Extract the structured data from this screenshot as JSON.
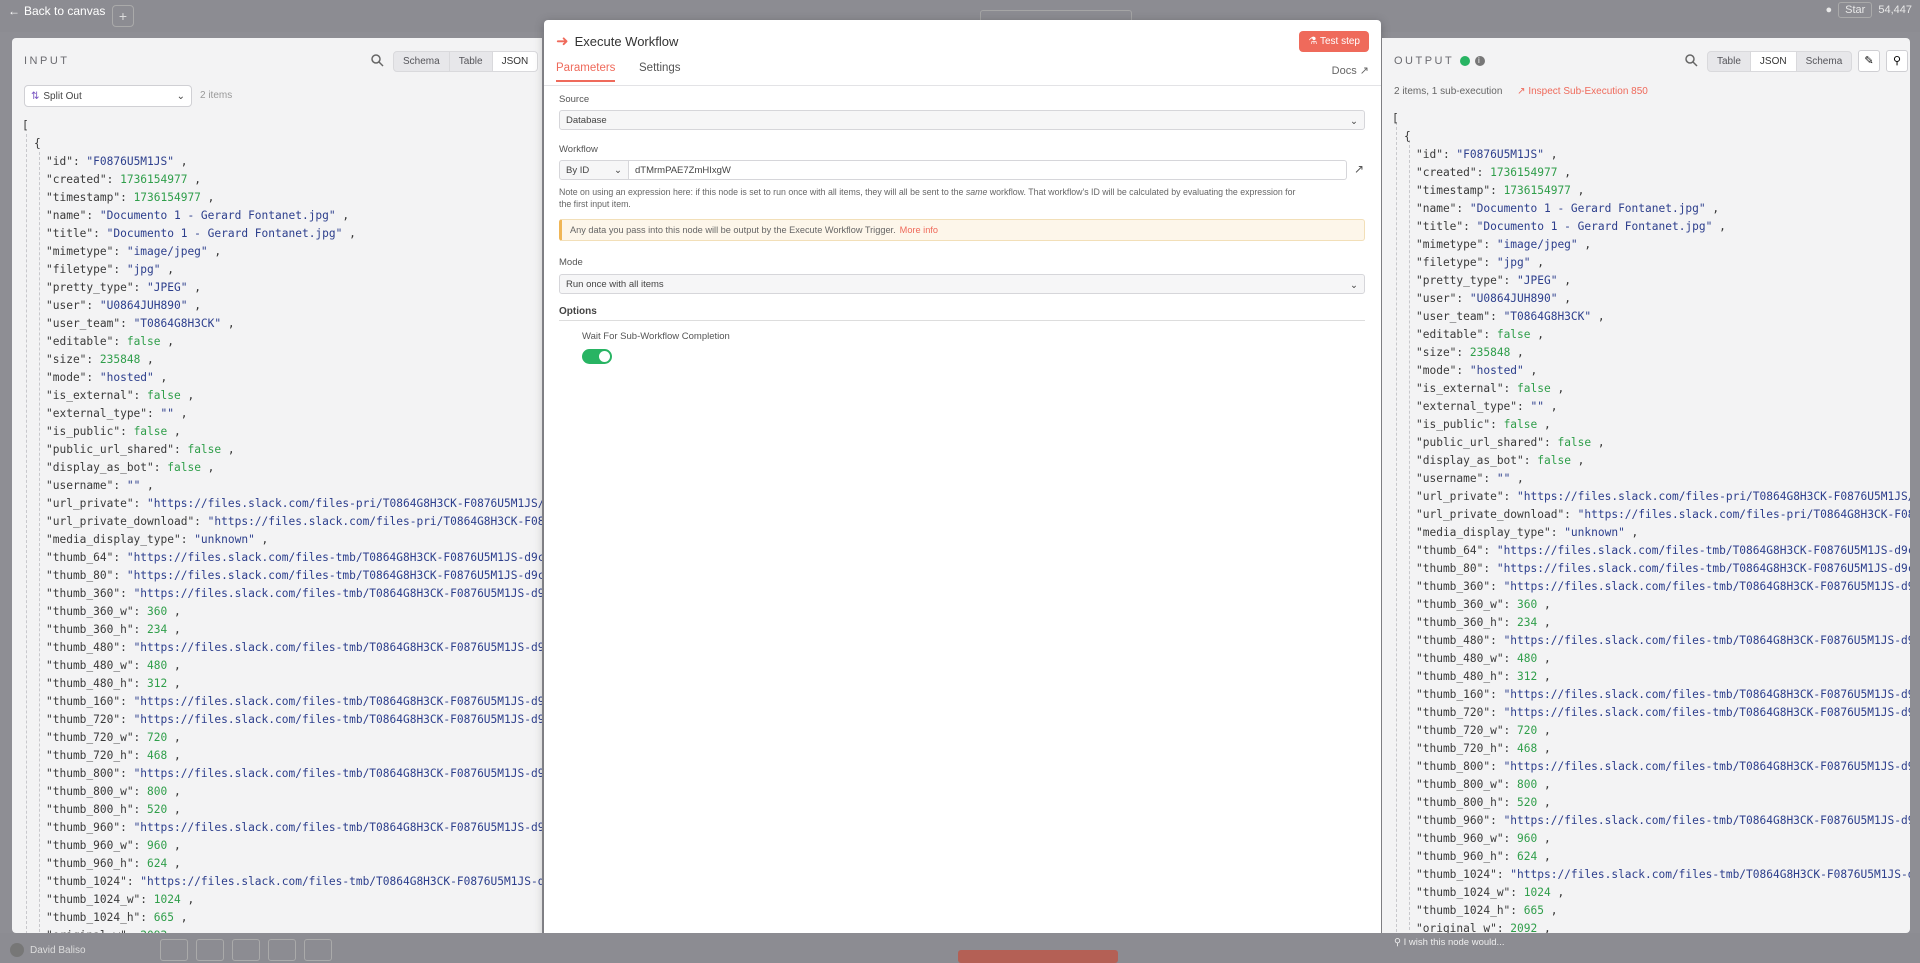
{
  "topbar": {
    "back_label": "Back to canvas",
    "star_label": "Star",
    "star_count": "54,447"
  },
  "input_panel": {
    "title": "INPUT",
    "views": [
      "Schema",
      "Table",
      "JSON"
    ],
    "active_view": "JSON",
    "node_select": "Split Out",
    "items_count": "2 items",
    "json_lines": [
      [
        "[",
        "p",
        0
      ],
      [
        "{",
        "p",
        1
      ],
      [
        "\"id\": ",
        "k",
        2,
        "\"F0876U5M1JS\"",
        "s"
      ],
      [
        "\"created\": ",
        "k",
        2,
        "1736154977",
        "n"
      ],
      [
        "\"timestamp\": ",
        "k",
        2,
        "1736154977",
        "n"
      ],
      [
        "\"name\": ",
        "k",
        2,
        "\"Documento 1 - Gerard Fontanet.jpg\"",
        "s"
      ],
      [
        "\"title\": ",
        "k",
        2,
        "\"Documento 1 - Gerard Fontanet.jpg\"",
        "s"
      ],
      [
        "\"mimetype\": ",
        "k",
        2,
        "\"image/jpeg\"",
        "s"
      ],
      [
        "\"filetype\": ",
        "k",
        2,
        "\"jpg\"",
        "s"
      ],
      [
        "\"pretty_type\": ",
        "k",
        2,
        "\"JPEG\"",
        "s"
      ],
      [
        "\"user\": ",
        "k",
        2,
        "\"U0864JUH890\"",
        "s"
      ],
      [
        "\"user_team\": ",
        "k",
        2,
        "\"T0864G8H3CK\"",
        "s"
      ],
      [
        "\"editable\": ",
        "k",
        2,
        "false",
        "b"
      ],
      [
        "\"size\": ",
        "k",
        2,
        "235848",
        "n"
      ],
      [
        "\"mode\": ",
        "k",
        2,
        "\"hosted\"",
        "s"
      ],
      [
        "\"is_external\": ",
        "k",
        2,
        "false",
        "b"
      ],
      [
        "\"external_type\": ",
        "k",
        2,
        "\"\"",
        "s"
      ],
      [
        "\"is_public\": ",
        "k",
        2,
        "false",
        "b"
      ],
      [
        "\"public_url_shared\": ",
        "k",
        2,
        "false",
        "b"
      ],
      [
        "\"display_as_bot\": ",
        "k",
        2,
        "false",
        "b"
      ],
      [
        "\"username\": ",
        "k",
        2,
        "\"\"",
        "s"
      ],
      [
        "\"url_private\": ",
        "k",
        2,
        "\"https://files.slack.com/files-pri/T0864G8H3CK-F0876U5M1JS/docu",
        "s"
      ],
      [
        "\"url_private_download\": ",
        "k",
        2,
        "\"https://files.slack.com/files-pri/T0864G8H3CK-F0876U5",
        "s"
      ],
      [
        "\"media_display_type\": ",
        "k",
        2,
        "\"unknown\"",
        "s"
      ],
      [
        "\"thumb_64\": ",
        "k",
        2,
        "\"https://files.slack.com/files-tmb/T0864G8H3CK-F0876U5M1JS-d9c9336",
        "s"
      ],
      [
        "\"thumb_80\": ",
        "k",
        2,
        "\"https://files.slack.com/files-tmb/T0864G8H3CK-F0876U5M1JS-d9c9336",
        "s"
      ],
      [
        "\"thumb_360\": ",
        "k",
        2,
        "\"https://files.slack.com/files-tmb/T0864G8H3CK-F0876U5M1JS-d9c933",
        "s"
      ],
      [
        "\"thumb_360_w\": ",
        "k",
        2,
        "360",
        "n"
      ],
      [
        "\"thumb_360_h\": ",
        "k",
        2,
        "234",
        "n"
      ],
      [
        "\"thumb_480\": ",
        "k",
        2,
        "\"https://files.slack.com/files-tmb/T0864G8H3CK-F0876U5M1JS-d9c933",
        "s"
      ],
      [
        "\"thumb_480_w\": ",
        "k",
        2,
        "480",
        "n"
      ],
      [
        "\"thumb_480_h\": ",
        "k",
        2,
        "312",
        "n"
      ],
      [
        "\"thumb_160\": ",
        "k",
        2,
        "\"https://files.slack.com/files-tmb/T0864G8H3CK-F0876U5M1JS-d9c933",
        "s"
      ],
      [
        "\"thumb_720\": ",
        "k",
        2,
        "\"https://files.slack.com/files-tmb/T0864G8H3CK-F0876U5M1JS-d9c933",
        "s"
      ],
      [
        "\"thumb_720_w\": ",
        "k",
        2,
        "720",
        "n"
      ],
      [
        "\"thumb_720_h\": ",
        "k",
        2,
        "468",
        "n"
      ],
      [
        "\"thumb_800\": ",
        "k",
        2,
        "\"https://files.slack.com/files-tmb/T0864G8H3CK-F0876U5M1JS-d9c933",
        "s"
      ],
      [
        "\"thumb_800_w\": ",
        "k",
        2,
        "800",
        "n"
      ],
      [
        "\"thumb_800_h\": ",
        "k",
        2,
        "520",
        "n"
      ],
      [
        "\"thumb_960\": ",
        "k",
        2,
        "\"https://files.slack.com/files-tmb/T0864G8H3CK-F0876U5M1JS-d9c933",
        "s"
      ],
      [
        "\"thumb_960_w\": ",
        "k",
        2,
        "960",
        "n"
      ],
      [
        "\"thumb_960_h\": ",
        "k",
        2,
        "624",
        "n"
      ],
      [
        "\"thumb_1024\": ",
        "k",
        2,
        "\"https://files.slack.com/files-tmb/T0864G8H3CK-F0876U5M1JS-d9c933",
        "s"
      ],
      [
        "\"thumb_1024_w\": ",
        "k",
        2,
        "1024",
        "n"
      ],
      [
        "\"thumb_1024_h\": ",
        "k",
        2,
        "665",
        "n"
      ],
      [
        "\"original_w\": ",
        "k",
        2,
        "2092",
        "n"
      ]
    ]
  },
  "modal": {
    "title": "Execute Workflow",
    "test_button": "Test step",
    "tabs": [
      "Parameters",
      "Settings"
    ],
    "active_tab": "Parameters",
    "docs_label": "Docs",
    "source_label": "Source",
    "source_value": "Database",
    "workflow_label": "Workflow",
    "workflow_mode": "By ID",
    "workflow_id": "dTMrmPAE7ZmHIxgW",
    "note_part1": "Note on using an expression here: if this node is set to run once with all items, they will all be sent to the ",
    "note_em": "same",
    "note_part2": " workflow. That workflow's ID will be calculated by evaluating the expression for",
    "note_line2": "the first input item.",
    "notice_text": "Any data you pass into this node will be output by the Execute Workflow Trigger.",
    "notice_link": "More info",
    "mode_label": "Mode",
    "mode_value": "Run once with all items",
    "options_title": "Options",
    "option_wait_label": "Wait For Sub-Workflow Completion",
    "option_wait_on": true
  },
  "output_panel": {
    "title": "OUTPUT",
    "views": [
      "Table",
      "JSON",
      "Schema"
    ],
    "active_view": "JSON",
    "summary": "2 items, 1 sub-execution",
    "inspect_link": "Inspect Sub-Execution 850",
    "wish_text": "I wish this node would...",
    "json_lines": [
      [
        "[",
        "p",
        0
      ],
      [
        "{",
        "p",
        1
      ],
      [
        "\"id\": ",
        "k",
        2,
        "\"F0876U5M1JS\"",
        "s"
      ],
      [
        "\"created\": ",
        "k",
        2,
        "1736154977",
        "n"
      ],
      [
        "\"timestamp\": ",
        "k",
        2,
        "1736154977",
        "n"
      ],
      [
        "\"name\": ",
        "k",
        2,
        "\"Documento 1 - Gerard Fontanet.jpg\"",
        "s"
      ],
      [
        "\"title\": ",
        "k",
        2,
        "\"Documento 1 - Gerard Fontanet.jpg\"",
        "s"
      ],
      [
        "\"mimetype\": ",
        "k",
        2,
        "\"image/jpeg\"",
        "s"
      ],
      [
        "\"filetype\": ",
        "k",
        2,
        "\"jpg\"",
        "s"
      ],
      [
        "\"pretty_type\": ",
        "k",
        2,
        "\"JPEG\"",
        "s"
      ],
      [
        "\"user\": ",
        "k",
        2,
        "\"U0864JUH890\"",
        "s"
      ],
      [
        "\"user_team\": ",
        "k",
        2,
        "\"T0864G8H3CK\"",
        "s"
      ],
      [
        "\"editable\": ",
        "k",
        2,
        "false",
        "b"
      ],
      [
        "\"size\": ",
        "k",
        2,
        "235848",
        "n"
      ],
      [
        "\"mode\": ",
        "k",
        2,
        "\"hosted\"",
        "s"
      ],
      [
        "\"is_external\": ",
        "k",
        2,
        "false",
        "b"
      ],
      [
        "\"external_type\": ",
        "k",
        2,
        "\"\"",
        "s"
      ],
      [
        "\"is_public\": ",
        "k",
        2,
        "false",
        "b"
      ],
      [
        "\"public_url_shared\": ",
        "k",
        2,
        "false",
        "b"
      ],
      [
        "\"display_as_bot\": ",
        "k",
        2,
        "false",
        "b"
      ],
      [
        "\"username\": ",
        "k",
        2,
        "\"\"",
        "s"
      ],
      [
        "\"url_private\": ",
        "k",
        2,
        "\"https://files.slack.com/files-pri/T0864G8H3CK-F0876U5M1JS/docu",
        "s"
      ],
      [
        "\"url_private_download\": ",
        "k",
        2,
        "\"https://files.slack.com/files-pri/T0864G8H3CK-F0876U5",
        "s"
      ],
      [
        "\"media_display_type\": ",
        "k",
        2,
        "\"unknown\"",
        "s"
      ],
      [
        "\"thumb_64\": ",
        "k",
        2,
        "\"https://files.slack.com/files-tmb/T0864G8H3CK-F0876U5M1JS-d9c9336",
        "s"
      ],
      [
        "\"thumb_80\": ",
        "k",
        2,
        "\"https://files.slack.com/files-tmb/T0864G8H3CK-F0876U5M1JS-d9c9336",
        "s"
      ],
      [
        "\"thumb_360\": ",
        "k",
        2,
        "\"https://files.slack.com/files-tmb/T0864G8H3CK-F0876U5M1JS-d9c933",
        "s"
      ],
      [
        "\"thumb_360_w\": ",
        "k",
        2,
        "360",
        "n"
      ],
      [
        "\"thumb_360_h\": ",
        "k",
        2,
        "234",
        "n"
      ],
      [
        "\"thumb_480\": ",
        "k",
        2,
        "\"https://files.slack.com/files-tmb/T0864G8H3CK-F0876U5M1JS-d9c933",
        "s"
      ],
      [
        "\"thumb_480_w\": ",
        "k",
        2,
        "480",
        "n"
      ],
      [
        "\"thumb_480_h\": ",
        "k",
        2,
        "312",
        "n"
      ],
      [
        "\"thumb_160\": ",
        "k",
        2,
        "\"https://files.slack.com/files-tmb/T0864G8H3CK-F0876U5M1JS-d9c933",
        "s"
      ],
      [
        "\"thumb_720\": ",
        "k",
        2,
        "\"https://files.slack.com/files-tmb/T0864G8H3CK-F0876U5M1JS-d9c933",
        "s"
      ],
      [
        "\"thumb_720_w\": ",
        "k",
        2,
        "720",
        "n"
      ],
      [
        "\"thumb_720_h\": ",
        "k",
        2,
        "468",
        "n"
      ],
      [
        "\"thumb_800\": ",
        "k",
        2,
        "\"https://files.slack.com/files-tmb/T0864G8H3CK-F0876U5M1JS-d9c933",
        "s"
      ],
      [
        "\"thumb_800_w\": ",
        "k",
        2,
        "800",
        "n"
      ],
      [
        "\"thumb_800_h\": ",
        "k",
        2,
        "520",
        "n"
      ],
      [
        "\"thumb_960\": ",
        "k",
        2,
        "\"https://files.slack.com/files-tmb/T0864G8H3CK-F0876U5M1JS-d9c933",
        "s"
      ],
      [
        "\"thumb_960_w\": ",
        "k",
        2,
        "960",
        "n"
      ],
      [
        "\"thumb_960_h\": ",
        "k",
        2,
        "624",
        "n"
      ],
      [
        "\"thumb_1024\": ",
        "k",
        2,
        "\"https://files.slack.com/files-tmb/T0864G8H3CK-F0876U5M1JS-d9c933",
        "s"
      ],
      [
        "\"thumb_1024_w\": ",
        "k",
        2,
        "1024",
        "n"
      ],
      [
        "\"thumb_1024_h\": ",
        "k",
        2,
        "665",
        "n"
      ],
      [
        "\"original_w\": ",
        "k",
        2,
        "2092",
        "n"
      ]
    ]
  },
  "bottombar": {
    "user_name": "David Baliso"
  },
  "colors": {
    "accent": "#ef6a5b",
    "success": "#28b463",
    "string": "#2c3e8c",
    "number": "#2f9e4a"
  }
}
